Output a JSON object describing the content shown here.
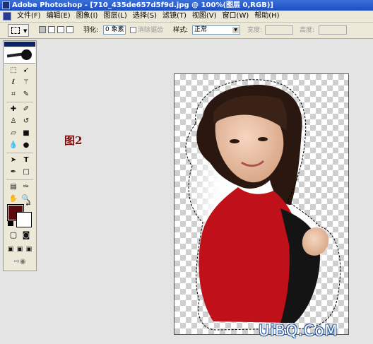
{
  "window": {
    "title": "Adobe Photoshop - [710_435de657d5f9d.jpg @ 100%(图层 0,RGB)]"
  },
  "menu": {
    "items": [
      "文件(F)",
      "编辑(E)",
      "图象(I)",
      "图层(L)",
      "选择(S)",
      "滤镜(T)",
      "视图(V)",
      "窗口(W)",
      "帮助(H)"
    ]
  },
  "options": {
    "feather_label": "羽化:",
    "feather_value": "0 象素",
    "antialias_label": "消除锯齿",
    "style_label": "样式:",
    "style_value": "正常",
    "width_label": "宽度:",
    "height_label": "高度:"
  },
  "canvas": {
    "figure_label": "图2"
  },
  "watermark": {
    "text": "UiBQ.CoM"
  },
  "colors": {
    "foreground": "#5a0b0b",
    "background": "#ffffff",
    "title_bar": "#1d4fc4"
  },
  "tools": [
    "marquee-tool",
    "move-tool",
    "lasso-tool",
    "magic-wand-tool",
    "crop-tool",
    "slice-tool",
    "healing-brush-tool",
    "brush-tool",
    "clone-stamp-tool",
    "history-brush-tool",
    "eraser-tool",
    "gradient-tool",
    "blur-tool",
    "dodge-tool",
    "path-selection-tool",
    "type-tool",
    "pen-tool",
    "shape-tool",
    "notes-tool",
    "eyedropper-tool",
    "hand-tool",
    "zoom-tool"
  ]
}
